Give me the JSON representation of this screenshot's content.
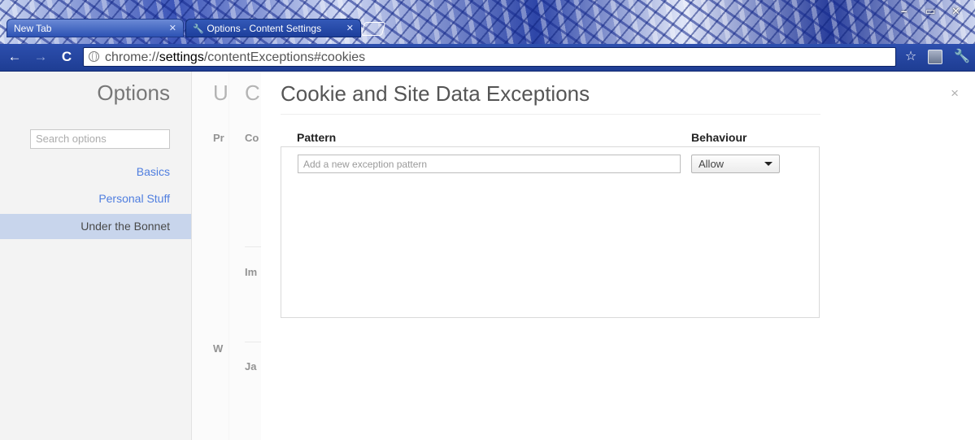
{
  "browser": {
    "tabs": [
      {
        "label": "New Tab",
        "active": false
      },
      {
        "label": "Options - Content Settings",
        "active": true
      }
    ],
    "url": {
      "prefix": "chrome://",
      "host": "settings",
      "path": "/contentExceptions#cookies"
    }
  },
  "sidebar": {
    "title": "Options",
    "search_placeholder": "Search options",
    "items": [
      {
        "label": "Basics",
        "selected": false
      },
      {
        "label": "Personal Stuff",
        "selected": false
      },
      {
        "label": "Under the Bonnet",
        "selected": true
      }
    ]
  },
  "background_pages": {
    "page1": {
      "title": "U",
      "labels": [
        "Pr",
        "W"
      ]
    },
    "page2": {
      "title": "C",
      "labels": [
        "Co",
        "Im",
        "Ja"
      ]
    }
  },
  "dialog": {
    "title": "Cookie and Site Data Exceptions",
    "close_glyph": "×",
    "columns": {
      "pattern": "Pattern",
      "behaviour": "Behaviour"
    },
    "new_pattern_placeholder": "Add a new exception pattern",
    "behaviour_selected": "Allow"
  },
  "colors": {
    "toolbar": "#1e3d93",
    "link": "#2962d9",
    "selected_item": "#bccde8"
  }
}
